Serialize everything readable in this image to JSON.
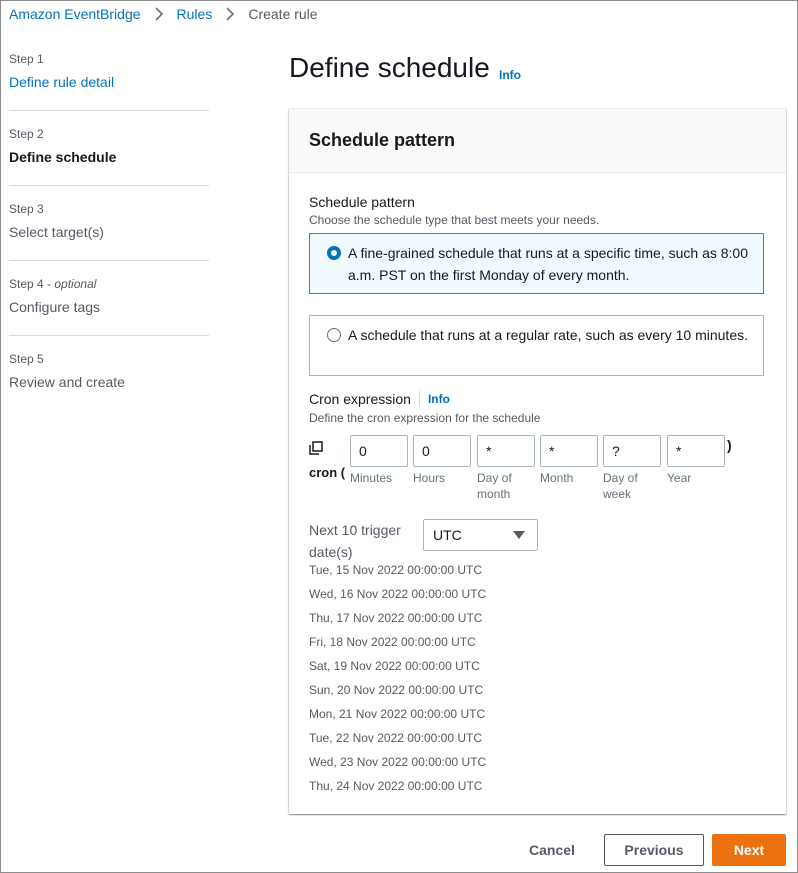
{
  "breadcrumb": {
    "items": [
      {
        "label": "Amazon EventBridge"
      },
      {
        "label": "Rules"
      },
      {
        "label": "Create rule"
      }
    ]
  },
  "steps": [
    {
      "number": "Step 1",
      "optional": "",
      "title": "Define rule detail",
      "state": "link"
    },
    {
      "number": "Step 2",
      "optional": "",
      "title": "Define schedule",
      "state": "active"
    },
    {
      "number": "Step 3",
      "optional": "",
      "title": "Select target(s)",
      "state": "disabled"
    },
    {
      "number": "Step 4",
      "optional": "optional",
      "title": "Configure tags",
      "state": "disabled"
    },
    {
      "number": "Step 5",
      "optional": "",
      "title": "Review and create",
      "state": "disabled"
    }
  ],
  "header": {
    "title": "Define schedule",
    "info": "Info"
  },
  "container": {
    "title": "Schedule pattern"
  },
  "schedule_pattern": {
    "label": "Schedule pattern",
    "description": "Choose the schedule type that best meets your needs.",
    "options": [
      {
        "text": "A fine-grained schedule that runs at a specific time, such as 8:00 a.m. PST on the first Monday of every month.",
        "selected": true
      },
      {
        "text": "A schedule that runs at a regular rate, such as every 10 minutes.",
        "selected": false
      }
    ]
  },
  "cron": {
    "label": "Cron expression",
    "info": "Info",
    "description": "Define the cron expression for the schedule",
    "prefix": "cron (",
    "suffix": ")",
    "fields": [
      {
        "value": "0",
        "label": "Minutes"
      },
      {
        "value": "0",
        "label": "Hours"
      },
      {
        "value": "*",
        "label": "Day of month"
      },
      {
        "value": "*",
        "label": "Month"
      },
      {
        "value": "?",
        "label": "Day of week"
      },
      {
        "value": "*",
        "label": "Year"
      }
    ]
  },
  "trigger_dates": {
    "label": "Next 10 trigger date(s)",
    "timezone": "UTC",
    "dates": [
      "Tue, 15 Nov 2022 00:00:00 UTC",
      "Wed, 16 Nov 2022 00:00:00 UTC",
      "Thu, 17 Nov 2022 00:00:00 UTC",
      "Fri, 18 Nov 2022 00:00:00 UTC",
      "Sat, 19 Nov 2022 00:00:00 UTC",
      "Sun, 20 Nov 2022 00:00:00 UTC",
      "Mon, 21 Nov 2022 00:00:00 UTC",
      "Tue, 22 Nov 2022 00:00:00 UTC",
      "Wed, 23 Nov 2022 00:00:00 UTC",
      "Thu, 24 Nov 2022 00:00:00 UTC"
    ]
  },
  "actions": {
    "cancel": "Cancel",
    "previous": "Previous",
    "next": "Next"
  },
  "colors": {
    "link": "#0073bb",
    "primary_button": "#ec7211",
    "selected_border": "#00a1c9",
    "selected_bg": "#f1faff"
  }
}
